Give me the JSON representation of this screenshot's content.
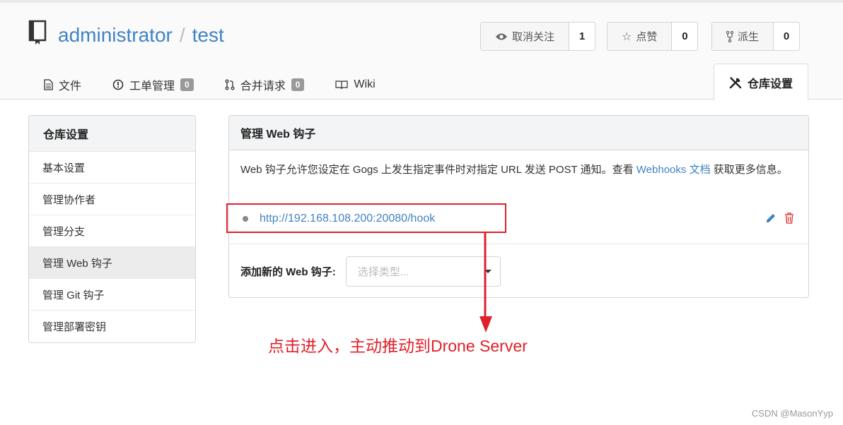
{
  "repo": {
    "owner": "administrator",
    "separator": "/",
    "name": "test"
  },
  "actions": {
    "watch": {
      "label": "取消关注",
      "count": "1"
    },
    "star": {
      "label": "点赞",
      "count": "0"
    },
    "fork": {
      "label": "派生",
      "count": "0"
    }
  },
  "tabs": [
    {
      "label": "文件",
      "icon": "file-icon"
    },
    {
      "label": "工单管理",
      "icon": "issue-icon",
      "badge": "0"
    },
    {
      "label": "合并请求",
      "icon": "pull-request-icon",
      "badge": "0"
    },
    {
      "label": "Wiki",
      "icon": "book-icon"
    }
  ],
  "settings_tab": {
    "label": "仓库设置",
    "icon": "tools-icon"
  },
  "sidebar": {
    "title": "仓库设置",
    "items": [
      {
        "label": "基本设置",
        "active": false
      },
      {
        "label": "管理协作者",
        "active": false
      },
      {
        "label": "管理分支",
        "active": false
      },
      {
        "label": "管理 Web 钩子",
        "active": true
      },
      {
        "label": "管理 Git 钩子",
        "active": false
      },
      {
        "label": "管理部署密钥",
        "active": false
      }
    ]
  },
  "panel": {
    "title": "管理 Web 钩子",
    "desc_before": "Web 钩子允许您设定在 Gogs 上发生指定事件时对指定 URL 发送 POST 通知。查看 ",
    "desc_link": "Webhooks 文档",
    "desc_after": " 获取更多信息。",
    "hook_url": "http://192.168.108.200:20080/hook",
    "add_label": "添加新的 Web 钩子:",
    "select_placeholder": "选择类型..."
  },
  "annotation": {
    "text": "点击进入，主动推动到Drone Server",
    "color": "#e0202a"
  },
  "watermark": "CSDN @MasonYyp",
  "colors": {
    "link": "#4183c4",
    "annotation_red": "#e0202a",
    "delete_red": "#db2828"
  }
}
